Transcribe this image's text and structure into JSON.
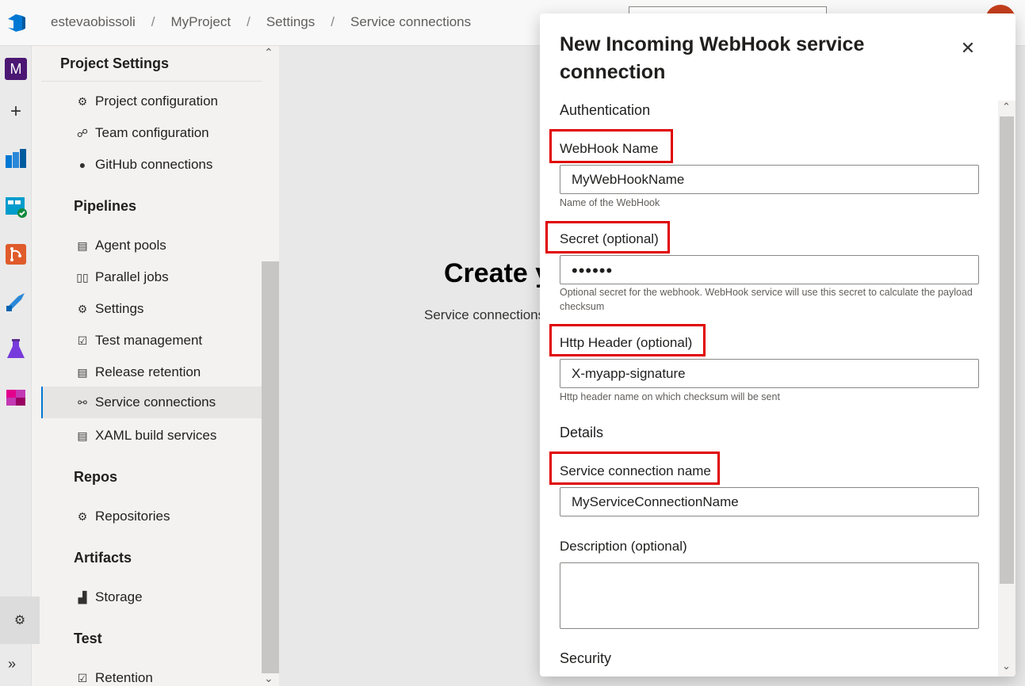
{
  "breadcrumb": {
    "items": [
      "estevaobissoli",
      "MyProject",
      "Settings",
      "Service connections"
    ],
    "separator": "/"
  },
  "rail": {
    "project_initial": "M",
    "add_symbol": "+",
    "gear_symbol": "⚙",
    "expand_symbol": "»"
  },
  "nav": {
    "title": "Project Settings",
    "general_items": [
      {
        "label": "Project configuration",
        "icon": "project-config-icon"
      },
      {
        "label": "Team configuration",
        "icon": "team-config-icon"
      },
      {
        "label": "GitHub connections",
        "icon": "github-icon"
      }
    ],
    "groups": {
      "pipelines": "Pipelines",
      "repos": "Repos",
      "artifacts": "Artifacts",
      "test": "Test"
    },
    "pipelines_items": [
      {
        "label": "Agent pools",
        "icon": "agent-pools-icon"
      },
      {
        "label": "Parallel jobs",
        "icon": "parallel-jobs-icon"
      },
      {
        "label": "Settings",
        "icon": "gear-icon"
      },
      {
        "label": "Test management",
        "icon": "test-management-icon"
      },
      {
        "label": "Release retention",
        "icon": "release-retention-icon"
      },
      {
        "label": "Service connections",
        "icon": "service-connections-icon",
        "selected": true
      },
      {
        "label": "XAML build services",
        "icon": "xaml-build-icon"
      }
    ],
    "repos_items": [
      {
        "label": "Repositories",
        "icon": "repositories-icon"
      }
    ],
    "artifacts_items": [
      {
        "label": "Storage",
        "icon": "storage-icon"
      }
    ],
    "test_items": [
      {
        "label": "Retention",
        "icon": "retention-icon"
      }
    ]
  },
  "main": {
    "title": "Create y",
    "subtitle": "Service connections"
  },
  "panel": {
    "title": "New Incoming WebHook service connection",
    "close_symbol": "✕",
    "authentication_heading": "Authentication",
    "webhook_name": {
      "label": "WebHook Name",
      "value": "MyWebHookName",
      "helper": "Name of the WebHook"
    },
    "secret": {
      "label": "Secret (optional)",
      "value": "••••••",
      "helper": "Optional secret for the webhook. WebHook service will use this secret to calculate the payload checksum"
    },
    "http_header": {
      "label": "Http Header (optional)",
      "value": "X-myapp-signature",
      "helper": "Http header name on which checksum will be sent"
    },
    "details_heading": "Details",
    "service_connection_name": {
      "label": "Service connection name",
      "value": "MyServiceConnectionName"
    },
    "description": {
      "label": "Description (optional)",
      "value": ""
    },
    "security_heading": "Security"
  },
  "colors": {
    "highlight_box": "#e00000",
    "accent": "#0078d4",
    "project_badge": "#4b1773"
  }
}
